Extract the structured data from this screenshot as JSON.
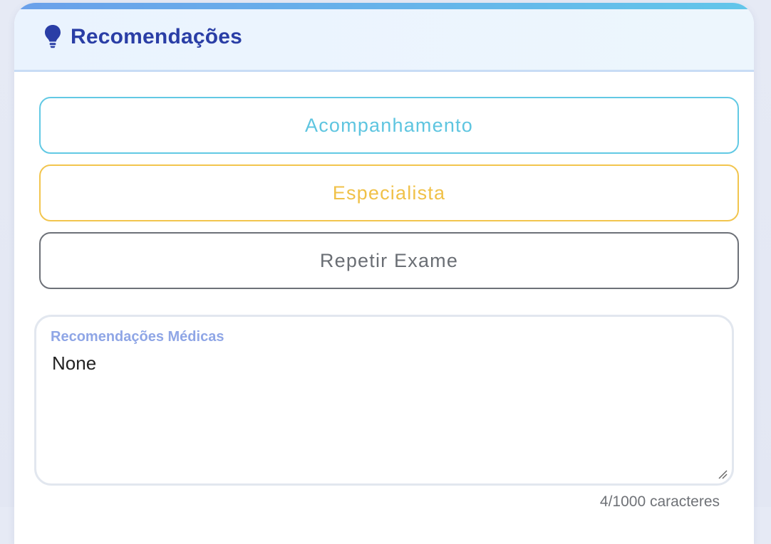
{
  "panel": {
    "title": "Recomendações",
    "title_icon": "lightbulb-icon",
    "accent_color": "#2a3ea6"
  },
  "options": [
    {
      "label": "Acompanhamento",
      "color": "#5ec5e0"
    },
    {
      "label": "Especialista",
      "color": "#f0c148"
    },
    {
      "label": "Repetir Exame",
      "color": "#6a6e74"
    }
  ],
  "notes": {
    "label": "Recomendações Médicas",
    "value": "None",
    "char_count": "4/1000 caracteres"
  }
}
